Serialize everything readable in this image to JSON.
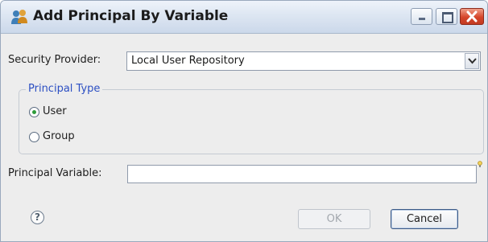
{
  "window": {
    "title": "Add Principal By Variable"
  },
  "form": {
    "security_provider_label": "Security Provider:",
    "security_provider_value": "Local User Repository",
    "principal_type_group_title": "Principal Type",
    "principal_type_options": [
      {
        "label": "User",
        "selected": true
      },
      {
        "label": "Group",
        "selected": false
      }
    ],
    "principal_variable_label": "Principal Variable:",
    "principal_variable_value": ""
  },
  "buttons": {
    "ok_label": "OK",
    "cancel_label": "Cancel",
    "help_glyph": "?"
  },
  "icons": {
    "app": "principal-people-icon",
    "help": "help-icon",
    "content_assist": "lightbulb-icon"
  },
  "colors": {
    "group_title": "#2c4fc3",
    "radio_selected": "#2e9c3a",
    "close_button": "#d5452a"
  }
}
